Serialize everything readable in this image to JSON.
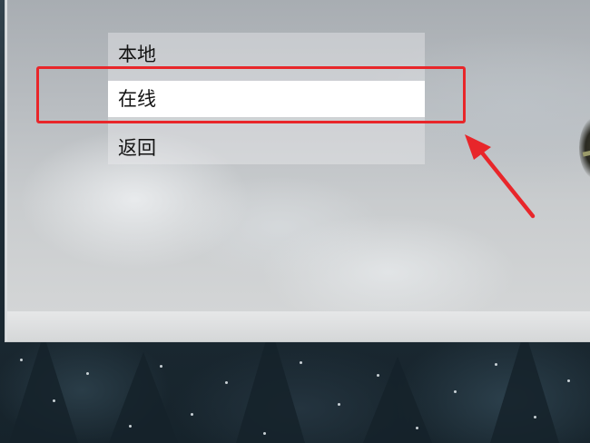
{
  "menu": {
    "items": [
      {
        "label": "本地",
        "selected": false
      },
      {
        "label": "在线",
        "selected": true
      },
      {
        "label": "返回",
        "selected": false
      }
    ]
  },
  "annotation": {
    "color": "#e8262a",
    "target": "在线"
  },
  "colors": {
    "menu_background": "rgba(235,237,239,0.42)",
    "selected_item_background": "#ffffff",
    "annotation_red": "#e8262a"
  }
}
